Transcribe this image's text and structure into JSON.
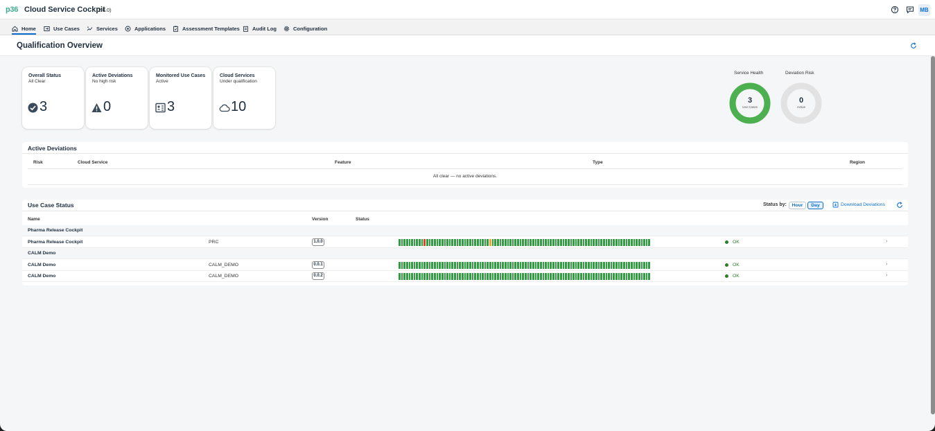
{
  "app": {
    "logo": "p36",
    "title": "Cloud Service Cockpit",
    "version": "(2.6.0)",
    "user_initials": "MB"
  },
  "nav": [
    {
      "label": "Home",
      "icon": "home-icon",
      "active": true
    },
    {
      "label": "Use Cases",
      "icon": "use-cases-icon"
    },
    {
      "label": "Services",
      "icon": "services-icon"
    },
    {
      "label": "Applications",
      "icon": "applications-icon"
    },
    {
      "label": "Assessment Templates",
      "icon": "clipboard-icon"
    },
    {
      "label": "Audit Log",
      "icon": "audit-log-icon"
    },
    {
      "label": "Configuration",
      "icon": "gear-icon"
    }
  ],
  "page": {
    "title": "Qualification Overview"
  },
  "tiles": [
    {
      "title": "Overall Status",
      "subtitle": "All Clear",
      "value": "3",
      "icon": "check-circle-icon"
    },
    {
      "title": "Active Deviations",
      "subtitle": "No high risk",
      "value": "0",
      "icon": "warning-icon"
    },
    {
      "title": "Monitored Use Cases",
      "subtitle": "Active",
      "value": "3",
      "icon": "monitored-use-cases-icon"
    },
    {
      "title": "Cloud Services",
      "subtitle": "Under qualification",
      "value": "10",
      "icon": "cloud-icon"
    }
  ],
  "donuts": [
    {
      "title": "Service Health",
      "value": "3",
      "label": "Use Cases",
      "color": "#4caf50"
    },
    {
      "title": "Deviation Risk",
      "value": "0",
      "label": "Active",
      "color": "#e0e0e0"
    }
  ],
  "deviations": {
    "title": "Active Deviations",
    "columns": [
      "Risk",
      "Cloud Service",
      "Feature",
      "Type",
      "Region"
    ],
    "empty_text": "All clear — no active deviations."
  },
  "use_case_status": {
    "title": "Use Case Status",
    "status_by_label": "Status by:",
    "segments": [
      "Hour",
      "Day"
    ],
    "selected_segment": "Day",
    "download_label": "Download Deviations",
    "columns": [
      "Name",
      "Version",
      "Status"
    ],
    "rows": [
      {
        "type": "group",
        "name": "Pharma Release Cockpit"
      },
      {
        "type": "item",
        "name": "Pharma Release Cockpit",
        "service": "PRC",
        "version": "1.0.0",
        "status": "OK",
        "bar": "GGGGGRRGGGGGGGGGGGGGGGGGRGGGGGGGGGGGGGGGGGGGGGGGGGGGGGGGGGGGGGGGGGGGGGGGGGGGGGGGGGGGGGOGGGGGGGGGGGGGGGGGGGGGGGGGGGGGGGGGGGGGGGGGGGGGGGGGGGGGGGGGGGGGGGGGGGGGGGGGGGGGGGGGGGGGGGGGGGGGGGGGGGGGGGGGGGGGGGGGGGGGGGGGGGGGGGGGGGGGGGGGGGGGGGGGGGGGGGGGG"
      },
      {
        "type": "group",
        "name": "CALM Demo"
      },
      {
        "type": "item",
        "name": "CALM Demo",
        "service": "CALM_DEMO",
        "version": "0.0.1",
        "status": "OK",
        "bar": "all-green"
      },
      {
        "type": "item",
        "name": "CALM Demo",
        "service": "CALM_DEMO",
        "version": "0.0.2",
        "status": "OK",
        "bar": "all-green"
      }
    ]
  },
  "colors": {
    "ok": "#2e9e3e",
    "deviation": "#e0402a",
    "warning": "#f2a33a",
    "accent": "#0a6ed1"
  }
}
